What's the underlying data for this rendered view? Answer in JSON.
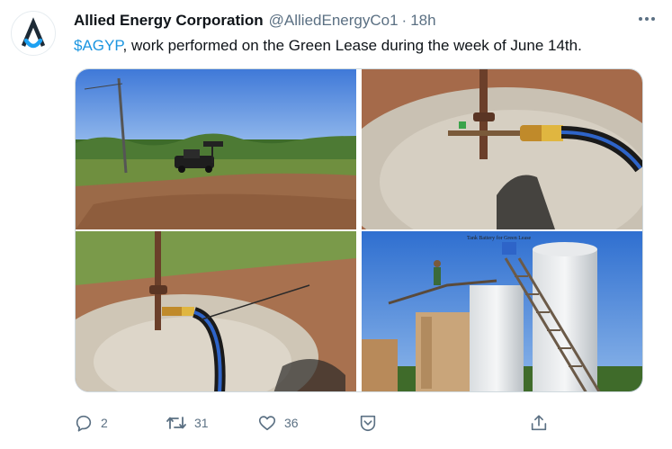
{
  "tweet": {
    "author_name": "Allied Energy Corporation",
    "handle": "@AlliedEnergyCo1",
    "separator": "·",
    "time": "18h",
    "cashtag": "$AGYP",
    "text": ", work performed on the Green Lease during the week of June 14th.",
    "image_caption": "Tank Battery for Green Lease"
  },
  "actions": {
    "reply_count": "2",
    "retweet_count": "31",
    "like_count": "36"
  },
  "icons": {
    "avatar": "allied-logo-icon",
    "more": "more-icon",
    "reply": "reply-icon",
    "retweet": "retweet-icon",
    "like": "heart-icon",
    "tip": "tip-icon",
    "share": "share-icon"
  },
  "colors": {
    "link": "#1b95e0",
    "secondary_text": "#5b7083",
    "logo_blue": "#1da1f2"
  }
}
